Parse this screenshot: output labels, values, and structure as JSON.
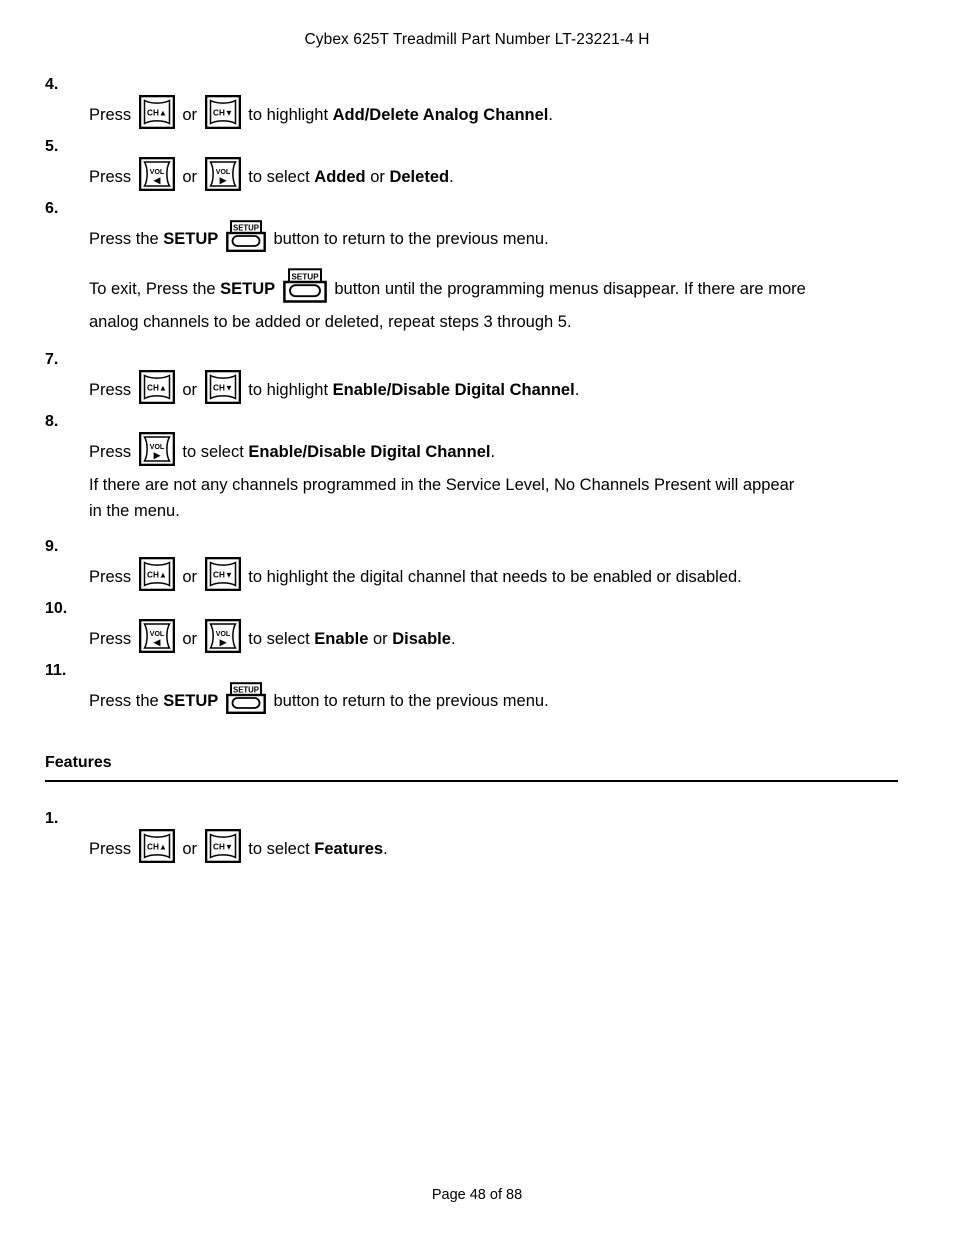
{
  "header": {
    "title": "Cybex 625T Treadmill Part Number LT-23221-4 H"
  },
  "footer": {
    "page_label": "Page 48 of 88"
  },
  "icons": {
    "ch_up": "channel-up-button-icon",
    "ch_down": "channel-down-button-icon",
    "vol_left": "volume-down-button-icon",
    "vol_right": "volume-up-button-icon",
    "setup": "setup-button-icon",
    "ch_up_label": "CH",
    "ch_down_label": "CH",
    "vol_label": "VOL",
    "setup_label": "SETUP",
    "up_arrow": "▲",
    "down_arrow": "▼",
    "left_arrow": "◀",
    "right_arrow": "▶"
  },
  "steps": [
    {
      "number": "4.",
      "parts": {
        "press": "Press",
        "or": "or",
        "tail_pre": "to highlight ",
        "tail_bold": "Add/Delete Analog Channel",
        "tail_post": "."
      }
    },
    {
      "number": "5.",
      "parts": {
        "press": "Press",
        "or": "or",
        "tail_pre": "to select ",
        "tail_bold1": "Added",
        "tail_mid": " or ",
        "tail_bold2": "Deleted",
        "tail_post": "."
      }
    },
    {
      "number": "6.",
      "parts": {
        "press_the": "Press the",
        "setup_bold": "SETUP",
        "tail": "button to return to the previous menu."
      },
      "extra_paragraph": {
        "lead": "To exit, Press the",
        "setup_bold": "SETUP",
        "mid": "button until the programming menus disappear. If there are more",
        "line2": "analog channels to be added or deleted, repeat steps 3 through 5."
      }
    },
    {
      "number": "7.",
      "parts": {
        "press": "Press",
        "or": "or",
        "tail_pre": "to highlight ",
        "tail_bold": "Enable/Disable Digital Channel",
        "tail_post": "."
      }
    },
    {
      "number": "8.",
      "parts": {
        "press": "Press",
        "tail_pre": "to select ",
        "tail_bold": "Enable/Disable Digital Channel",
        "tail_post": "."
      },
      "extra_paragraph": {
        "line1": "If there are not any channels programmed in the Service Level, No Channels Present will appear",
        "line2": "in the menu."
      }
    },
    {
      "number": "9.",
      "parts": {
        "press": "Press",
        "or": "or",
        "tail_pre": "to highlight the digital channel that needs to be enabled or disabled.",
        "tail_bold": "",
        "tail_post": ""
      }
    },
    {
      "number": "10.",
      "parts": {
        "press": "Press",
        "or": "or",
        "tail_pre": "to select ",
        "tail_bold1": "Enable",
        "tail_mid": " or ",
        "tail_bold2": "Disable",
        "tail_post": "."
      }
    },
    {
      "number": "11.",
      "parts": {
        "press_the": "Press the",
        "setup_bold": "SETUP",
        "tail": "button to return to the previous menu."
      }
    }
  ],
  "features_section": {
    "heading": "Features",
    "step": {
      "number": "1.",
      "parts": {
        "press": "Press",
        "or": "or",
        "tail_pre": "to select ",
        "tail_bold": "Features",
        "tail_post": "."
      }
    }
  },
  "colors": {
    "text": "#000000",
    "background": "#ffffff",
    "rule": "#000000"
  }
}
